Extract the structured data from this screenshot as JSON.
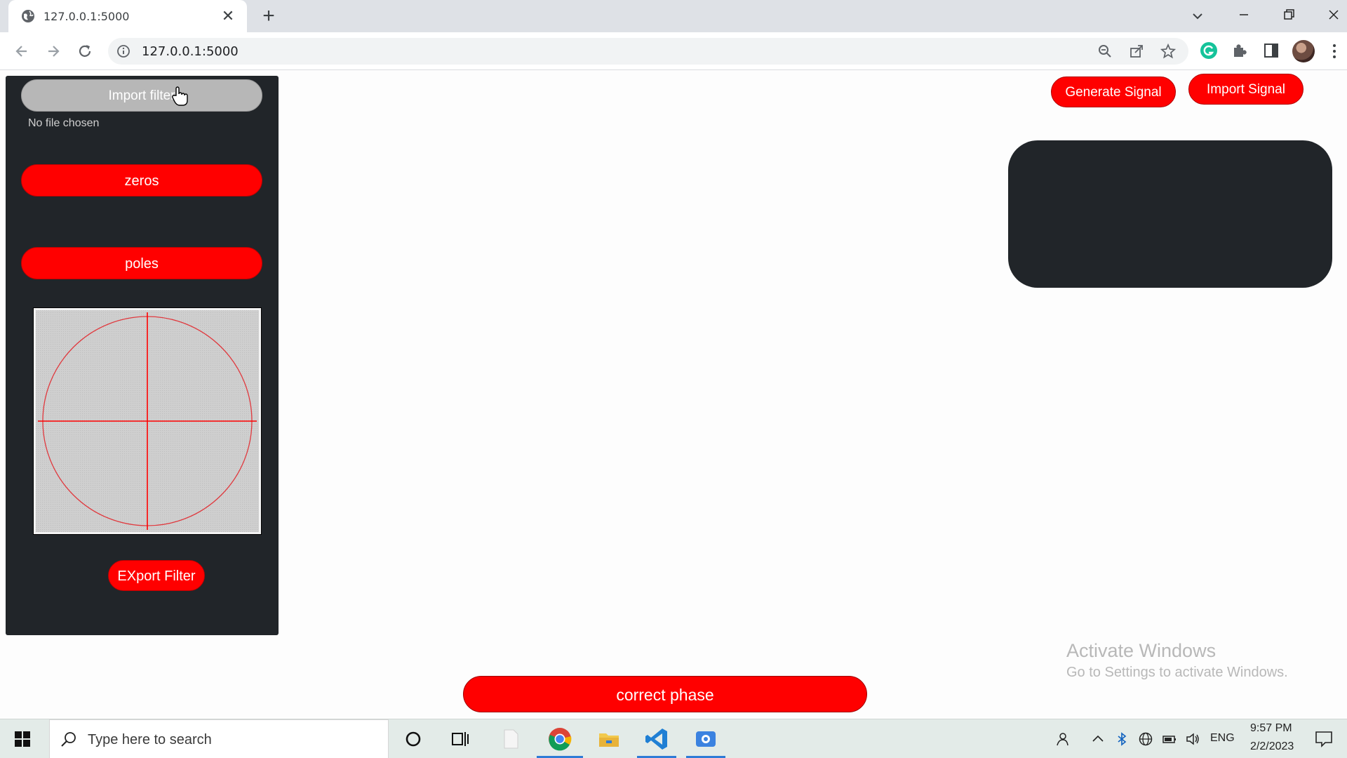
{
  "browser": {
    "tab_title": "127.0.0.1:5000",
    "tab_close": "✕",
    "new_tab": "+",
    "url": "127.0.0.1:5000"
  },
  "sidebar": {
    "import_filter_label": "Import filter",
    "file_status": "No file chosen",
    "zeros_label": "zeros",
    "poles_label": "poles",
    "export_label": "EXport Filter"
  },
  "zplane": {
    "axis_color": "#ff0000",
    "circle_color": "#e0393e"
  },
  "header": {
    "generate_label": "Generate Signal",
    "import_signal_label": "Import Signal"
  },
  "main": {
    "correct_phase_label": "correct phase"
  },
  "watermark": {
    "line1": "Activate Windows",
    "line2": "Go to Settings to activate Windows."
  },
  "taskbar": {
    "search_placeholder": "Type here to search",
    "lang": "ENG",
    "time": "9:57 PM",
    "date": "2/2/2023"
  },
  "colors": {
    "accent_red": "#ff0000",
    "panel_dark": "#212529"
  }
}
